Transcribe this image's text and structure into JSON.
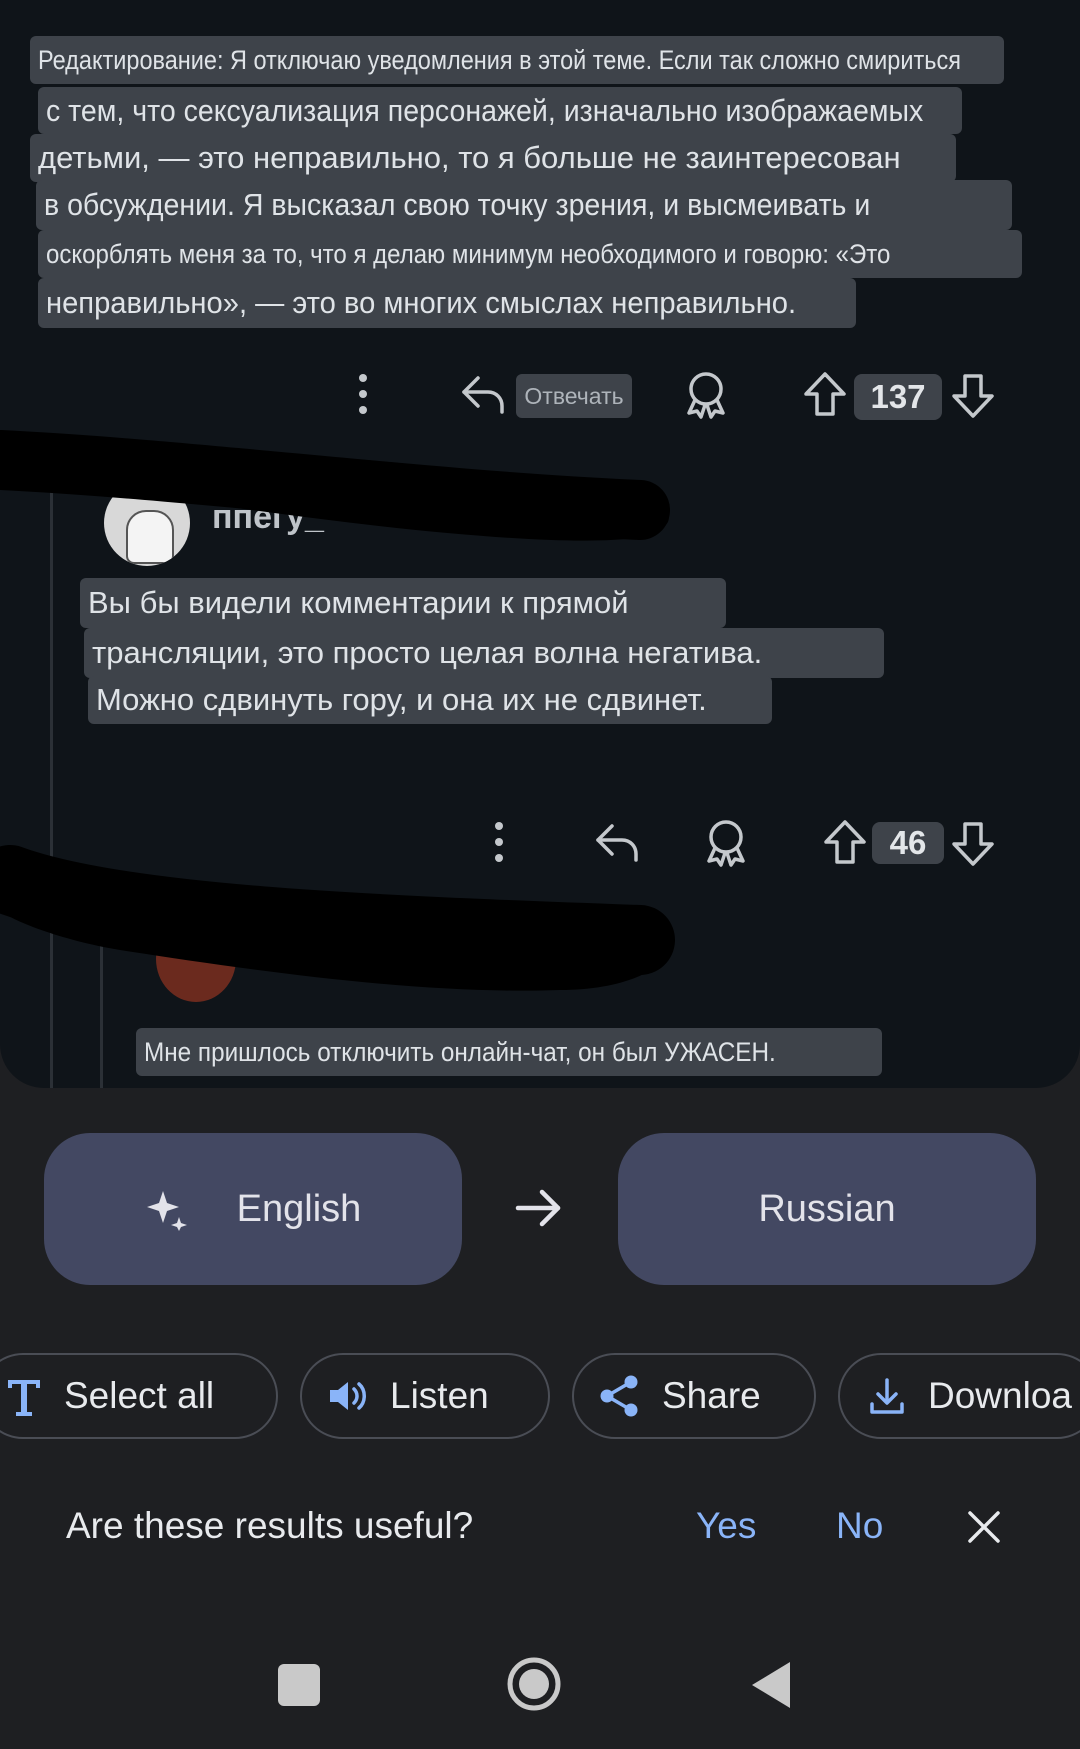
{
  "comment_main": {
    "lines": [
      "Редактирование: Я отключаю уведомления в этой теме. Если так сложно смириться",
      "с тем, что сексуализация персонажей, изначально изображаемых",
      "детьми, — это неправильно, то я больше не заинтересован",
      "в обсуждении. Я высказал свою точку зрения, и высмеивать и",
      "оскорблять меня за то, что я делаю минимум необходимого и говорю: «Это",
      "неправильно», — это во многих смыслах неправильно."
    ],
    "reply_label": "Отвечать",
    "vote_count": "137"
  },
  "comment_reply1": {
    "username_fragment": "ппегу_",
    "lines": [
      "Вы бы видели комментарии к прямой",
      "трансляции, это просто целая волна негатива.",
      "Можно сдвинуть гору, и она их не сдвинет."
    ],
    "vote_count": "46"
  },
  "comment_reply2": {
    "text": "Мне пришлось отключить онлайн-чат, он был УЖАСЕН."
  },
  "translate": {
    "source_lang": "English",
    "target_lang": "Russian",
    "arrow_icon": "arrow-right-icon",
    "sparkle_icon": "sparkle-icon"
  },
  "actions": {
    "select_all": "Select all",
    "listen": "Listen",
    "share": "Share",
    "download": "Downloa"
  },
  "feedback": {
    "question": "Are these results useful?",
    "yes": "Yes",
    "no": "No"
  },
  "colors": {
    "screen_bg": "#0f1419",
    "panel_bg": "#1e1f22",
    "lang_button": "#434862",
    "accent": "#8ab4f8",
    "text_highlight": "#3e434a"
  }
}
